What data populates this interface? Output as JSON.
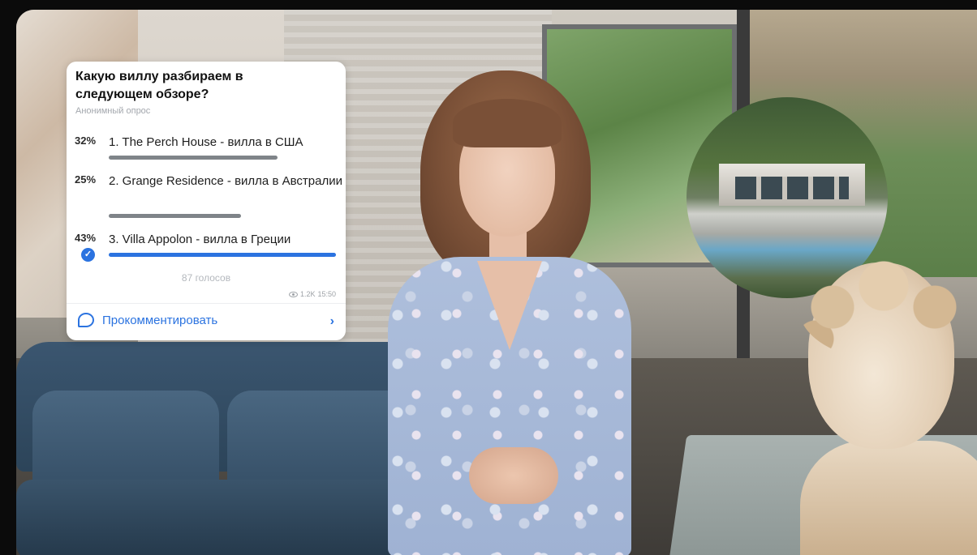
{
  "poll": {
    "question": "Какую виллу разбираем в следующем обзоре?",
    "subtitle": "Анонимный опрос",
    "options": [
      {
        "percent": "32%",
        "label": "1. The Perch House - вилла в США",
        "share": 0.32,
        "selected": false
      },
      {
        "percent": "25%",
        "label": "2. Grange Residence - вилла в Австралии",
        "share": 0.25,
        "selected": false
      },
      {
        "percent": "43%",
        "label": "3. Villa Appolon - вилла в Греции",
        "share": 0.43,
        "selected": true
      }
    ],
    "votes": "87 голосов",
    "views": "1.2K",
    "time": "15:50",
    "comment_label": "Прокомментировать",
    "colors": {
      "accent": "#2b73e0",
      "bar": "#7f8489"
    }
  }
}
